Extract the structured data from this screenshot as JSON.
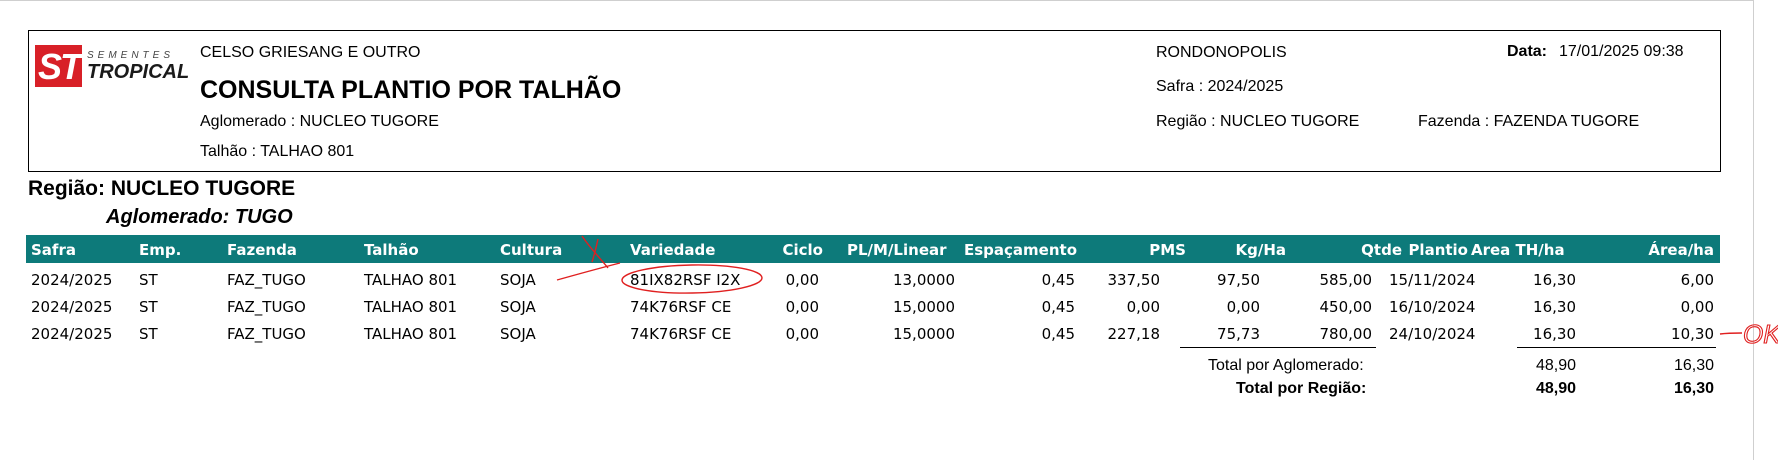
{
  "header": {
    "company": "CELSO GRIESANG E OUTRO",
    "title": "CONSULTA PLANTIO POR TALHÃO",
    "aglomerado": "Aglomerado : NUCLEO TUGORE",
    "talhao": "Talhão : TALHAO 801",
    "city": "RONDONOPOLIS",
    "safra": "Safra : 2024/2025",
    "regiao": "Região : NUCLEO TUGORE",
    "fazenda": "Fazenda : FAZENDA TUGORE",
    "data_label": "Data:",
    "data_value": "17/01/2025  09:38"
  },
  "logo": {
    "mark": "ST",
    "line1": "SEMENTES",
    "line2": "TROPICAL",
    "brand_color": "#d82027"
  },
  "group": {
    "regiao": "Região: NUCLEO TUGORE",
    "aglomerado": "Aglomerado: TUGO"
  },
  "table": {
    "header_color": "#0d7a7a",
    "columns": [
      "Safra",
      "Emp.",
      "Fazenda",
      "Talhão",
      "Cultura",
      "Variedade",
      "Ciclo",
      "PL/M/Linear",
      "Espaçamento",
      "PMS",
      "Kg/Ha",
      "Qtde",
      "Plantio",
      "Area TH/ha",
      "Área/ha"
    ],
    "rows": [
      [
        "2024/2025",
        "ST",
        "FAZ_TUGO",
        "TALHAO 801",
        "SOJA",
        "81IX82RSF I2X",
        "0,00",
        "13,0000",
        "0,45",
        "337,50",
        "97,50",
        "585,00",
        "15/11/2024",
        "16,30",
        "6,00"
      ],
      [
        "2024/2025",
        "ST",
        "FAZ_TUGO",
        "TALHAO 801",
        "SOJA",
        "74K76RSF CE",
        "0,00",
        "15,0000",
        "0,45",
        "0,00",
        "0,00",
        "450,00",
        "16/10/2024",
        "16,30",
        "0,00"
      ],
      [
        "2024/2025",
        "ST",
        "FAZ_TUGO",
        "TALHAO 801",
        "SOJA",
        "74K76RSF CE",
        "0,00",
        "15,0000",
        "0,45",
        "227,18",
        "75,73",
        "780,00",
        "24/10/2024",
        "16,30",
        "10,30"
      ]
    ]
  },
  "totals": {
    "aglomerado_label": "Total por Aglomerado:",
    "aglomerado_area_th": "48,90",
    "aglomerado_area": "16,30",
    "regiao_label": "Total por Região:",
    "regiao_area_th": "48,90",
    "regiao_area": "16,30"
  },
  "annotations": {
    "ok_mark": "OK",
    "ink_color": "#e02020"
  }
}
